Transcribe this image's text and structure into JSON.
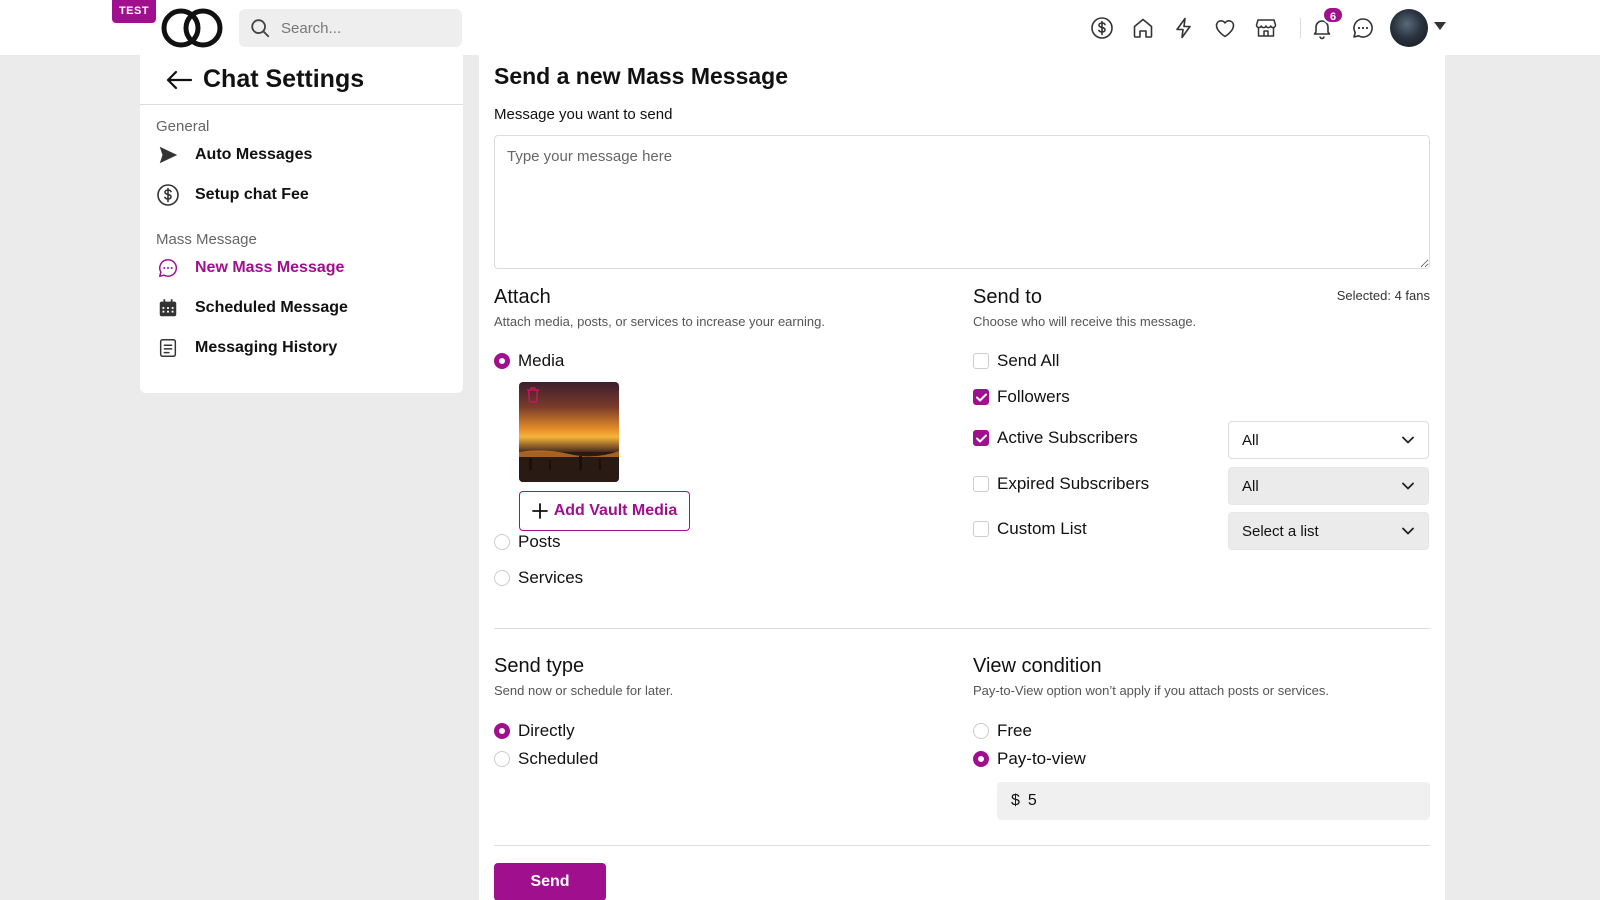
{
  "topbar": {
    "badge": "TEST",
    "search_placeholder": "Search...",
    "notifications_count": "6",
    "icons": [
      "dollar-icon",
      "home-icon",
      "lightning-icon",
      "heart-icon",
      "store-icon",
      "bell-icon",
      "chat-icon"
    ]
  },
  "sidebar": {
    "title": "Chat Settings",
    "sections": [
      {
        "label": "General",
        "items": [
          {
            "label": "Auto Messages",
            "icon": "send-icon"
          },
          {
            "label": "Setup chat Fee",
            "icon": "dollar-icon"
          }
        ]
      },
      {
        "label": "Mass Message",
        "items": [
          {
            "label": "New Mass Message",
            "icon": "chat-icon",
            "active": true
          },
          {
            "label": "Scheduled Message",
            "icon": "calendar-icon"
          },
          {
            "label": "Messaging History",
            "icon": "document-icon"
          }
        ]
      }
    ]
  },
  "main": {
    "title": "Send a new Mass Message",
    "message_label": "Message you want to send",
    "message_placeholder": "Type your message here",
    "attach": {
      "title": "Attach",
      "subtitle": "Attach media, posts, or services to increase your earning.",
      "options": [
        {
          "label": "Media",
          "selected": true
        },
        {
          "label": "Posts",
          "selected": false
        },
        {
          "label": "Services",
          "selected": false
        }
      ],
      "add_vault_label": "Add Vault Media"
    },
    "send_to": {
      "title": "Send to",
      "subtitle": "Choose who will receive this message.",
      "selected_text": "Selected: 4 fans",
      "options": [
        {
          "label": "Send All",
          "checked": false
        },
        {
          "label": "Followers",
          "checked": true
        },
        {
          "label": "Active Subscribers",
          "checked": true,
          "select": "All"
        },
        {
          "label": "Expired Subscribers",
          "checked": false,
          "select": "All"
        },
        {
          "label": "Custom List",
          "checked": false,
          "select": "Select a list"
        }
      ]
    },
    "send_type": {
      "title": "Send type",
      "subtitle": "Send now or schedule for later.",
      "options": [
        {
          "label": "Directly",
          "selected": true
        },
        {
          "label": "Scheduled",
          "selected": false
        }
      ]
    },
    "view_condition": {
      "title": "View condition",
      "subtitle": "Pay-to-View option won’t apply if you attach posts or services.",
      "options": [
        {
          "label": "Free",
          "selected": false
        },
        {
          "label": "Pay-to-view",
          "selected": true
        }
      ],
      "currency": "$",
      "price": "5"
    },
    "send_label": "Send"
  },
  "colors": {
    "accent": "#a0108e",
    "page_bg": "#ebebeb"
  }
}
